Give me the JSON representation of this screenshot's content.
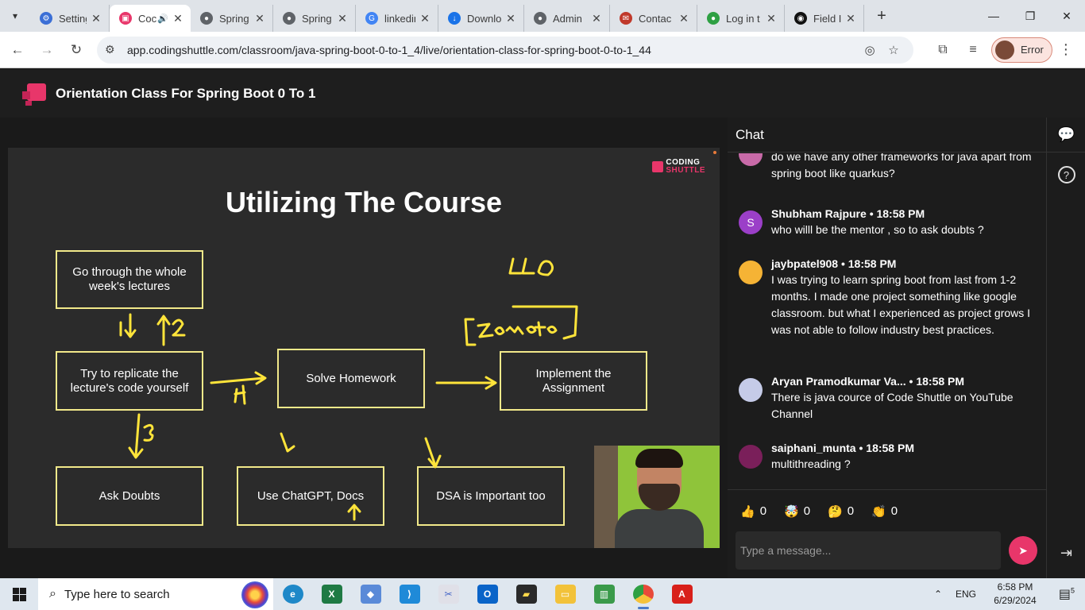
{
  "browser": {
    "tabs": [
      {
        "title": "Setting",
        "favicon": "gear-icon",
        "color": "#3b6fd6",
        "active": false
      },
      {
        "title": "Coc",
        "favicon": "codingshuttle-icon",
        "color": "#e8366a",
        "active": true,
        "audio": true
      },
      {
        "title": "Spring",
        "favicon": "globe-icon",
        "color": "#5f6368",
        "active": false
      },
      {
        "title": "Spring",
        "favicon": "globe-icon",
        "color": "#5f6368",
        "active": false
      },
      {
        "title": "linkedin",
        "favicon": "google-icon",
        "color": "#4285f4",
        "active": false
      },
      {
        "title": "Downlo",
        "favicon": "download-icon",
        "color": "#1a73e8",
        "active": false
      },
      {
        "title": "Admin",
        "favicon": "globe-icon",
        "color": "#5f6368",
        "active": false
      },
      {
        "title": "Contac",
        "favicon": "mail-icon",
        "color": "#c0392b",
        "active": false
      },
      {
        "title": "Log in t",
        "favicon": "green-circle-icon",
        "color": "#2ea043",
        "active": false
      },
      {
        "title": "Field In",
        "favicon": "medium-icon",
        "color": "#111111",
        "active": false
      }
    ],
    "url": "app.codingshuttle.com/classroom/java-spring-boot-0-to-1_4/live/orientation-class-for-spring-boot-0-to-1_44",
    "profile_label": "Error"
  },
  "page": {
    "title": "Orientation Class For Spring Boot 0 To 1"
  },
  "slide": {
    "brand_top": "CODING",
    "brand_bottom": "SHUTTLE",
    "title": "Utilizing The Course",
    "boxes": {
      "go_through": "Go through the whole week's lectures",
      "replicate": "Try to replicate the lecture's code yourself",
      "homework": "Solve Homework",
      "implement": "Implement the Assignment",
      "doubts": "Ask Doubts",
      "chatgpt": "Use ChatGPT, Docs",
      "dsa": "DSA is Important too"
    },
    "annotation_color": "#ffe43a",
    "box_color": "#f2e98a"
  },
  "chat": {
    "title": "Chat",
    "messages": [
      {
        "author": "",
        "time": "",
        "text": "do we have any other frameworks for java apart from spring boot like quarkus?",
        "avatar": "",
        "avatar_color": "#c86aa8"
      },
      {
        "author": "Shubham Rajpure",
        "time": "18:58 PM",
        "text": "who willl be the mentor , so to ask doubts ?",
        "avatar": "S",
        "avatar_color": "#9b3fc8"
      },
      {
        "author": "jaybpatel908",
        "time": "18:58 PM",
        "text": "I was trying to learn spring boot from last from 1-2 months. I made one project something like google classroom. but what I experienced as project grows I was not able to follow industry best practices.",
        "avatar": "",
        "avatar_color": "#f5b335"
      },
      {
        "author": "Aryan Pramodkumar Va...",
        "time": "18:58 PM",
        "text": "There is java cource of Code Shuttle on YouTube Channel",
        "avatar": "",
        "avatar_color": "#c5cbe8"
      },
      {
        "author": "saiphani_munta",
        "time": "18:58 PM",
        "text": "multithreading ?",
        "avatar": "",
        "avatar_color": "#7a1f5a"
      }
    ],
    "separator": "•",
    "reactions": [
      {
        "emoji": "👍",
        "count": "0"
      },
      {
        "emoji": "🤯",
        "count": "0"
      },
      {
        "emoji": "🤔",
        "count": "0"
      },
      {
        "emoji": "👏",
        "count": "0"
      }
    ],
    "input_placeholder": "Type a message..."
  },
  "taskbar": {
    "search_placeholder": "Type here to search",
    "language": "ENG",
    "time": "6:58 PM",
    "date": "6/29/2024",
    "notification_count": "5"
  }
}
